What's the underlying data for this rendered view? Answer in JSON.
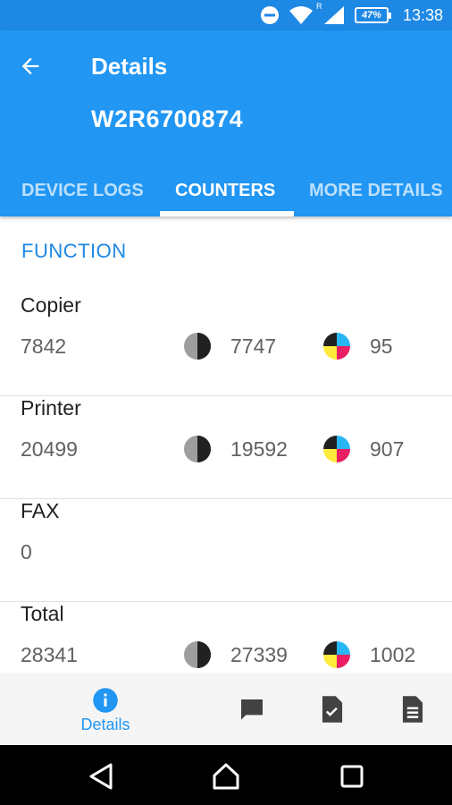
{
  "status_bar": {
    "time": "13:38",
    "battery": "47%",
    "roaming": "R",
    "icons": [
      "do-not-disturb-icon",
      "wifi-icon",
      "signal-icon",
      "battery-icon"
    ]
  },
  "app_bar": {
    "title": "Details",
    "subtitle": "W2R6700874",
    "color": "#2196f3",
    "tabs": [
      {
        "label": "DEVICE LOGS",
        "active": false
      },
      {
        "label": "COUNTERS",
        "active": true
      },
      {
        "label": "MORE DETAILS",
        "active": false
      }
    ]
  },
  "counters": {
    "section_title": "FUNCTION",
    "rows": [
      {
        "label": "Copier",
        "total": "7842",
        "mono": "7747",
        "color": "95"
      },
      {
        "label": "Printer",
        "total": "20499",
        "mono": "19592",
        "color": "907"
      },
      {
        "label": "FAX",
        "total": "0"
      },
      {
        "label": "Total",
        "total": "28341",
        "mono": "27339",
        "color": "1002"
      }
    ]
  },
  "bottom_nav": {
    "items": [
      {
        "label": "Details",
        "icon": "info-icon",
        "active": true
      },
      {
        "label": "",
        "icon": "message-icon",
        "active": false
      },
      {
        "label": "",
        "icon": "document-check-icon",
        "active": false
      },
      {
        "label": "",
        "icon": "document-list-icon",
        "active": false
      }
    ],
    "accent": "#2196f3"
  },
  "system_nav": {
    "buttons": [
      "back-icon",
      "home-icon",
      "recents-icon"
    ]
  }
}
